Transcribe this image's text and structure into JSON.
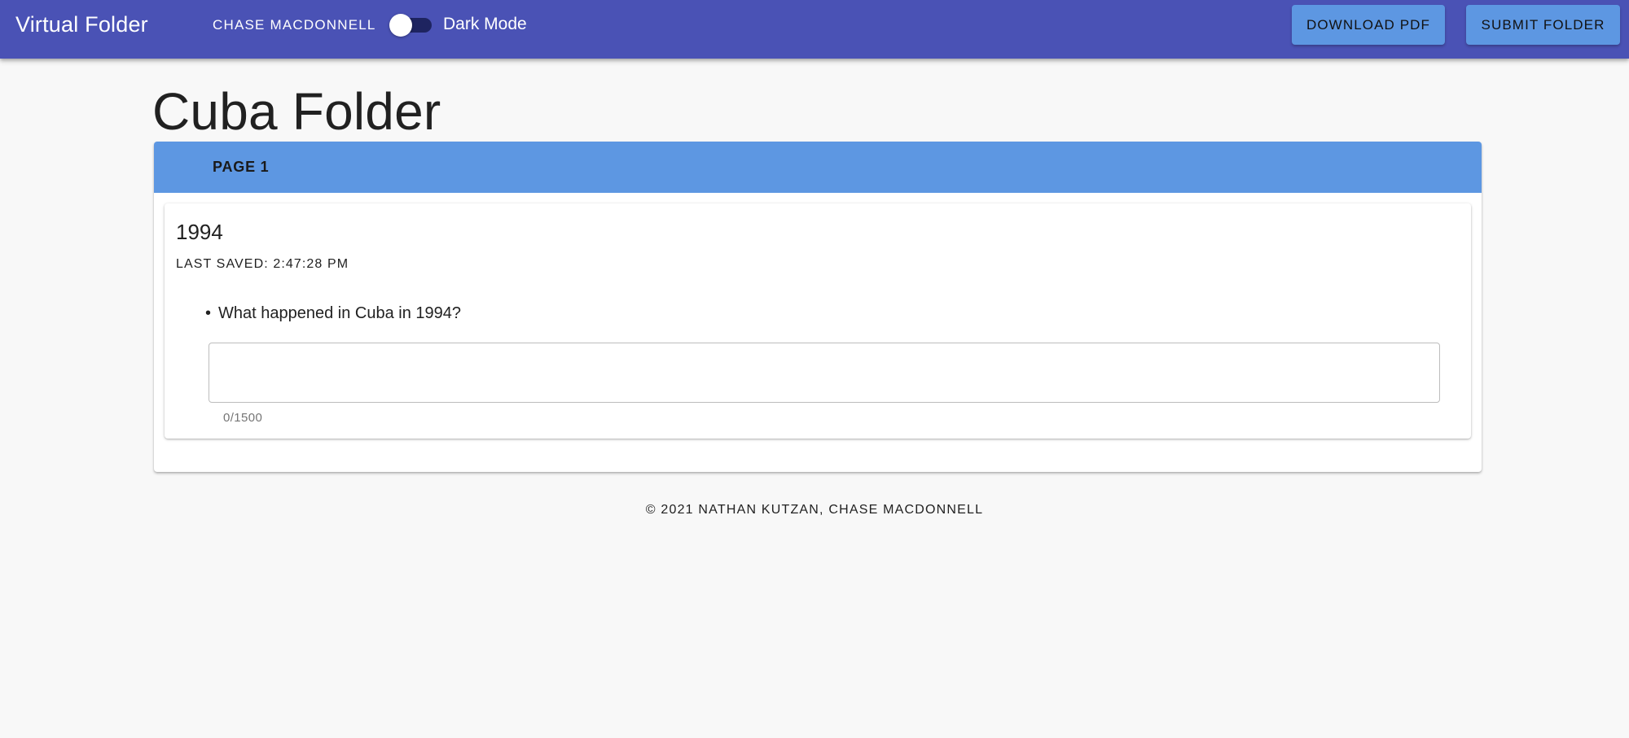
{
  "header": {
    "app_title": "Virtual Folder",
    "user_name": "CHASE MACDONNELL",
    "dark_mode": {
      "label": "Dark Mode",
      "enabled": false
    },
    "download_label": "DOWNLOAD PDF",
    "submit_label": "SUBMIT FOLDER",
    "colors": {
      "appbar": "#4a52b5",
      "button": "#5d97e2"
    }
  },
  "page": {
    "title": "Cuba Folder"
  },
  "tabs": [
    {
      "label": "PAGE 1",
      "active": true
    }
  ],
  "card": {
    "title": "1994",
    "last_saved_label": "LAST SAVED:",
    "last_saved_time": "2:47:28 PM",
    "question": "What happened in Cuba in 1994?",
    "answer_value": "",
    "counter": "0/1500"
  },
  "footer": {
    "text": "© 2021 NATHAN KUTZAN, CHASE MACDONNELL"
  }
}
